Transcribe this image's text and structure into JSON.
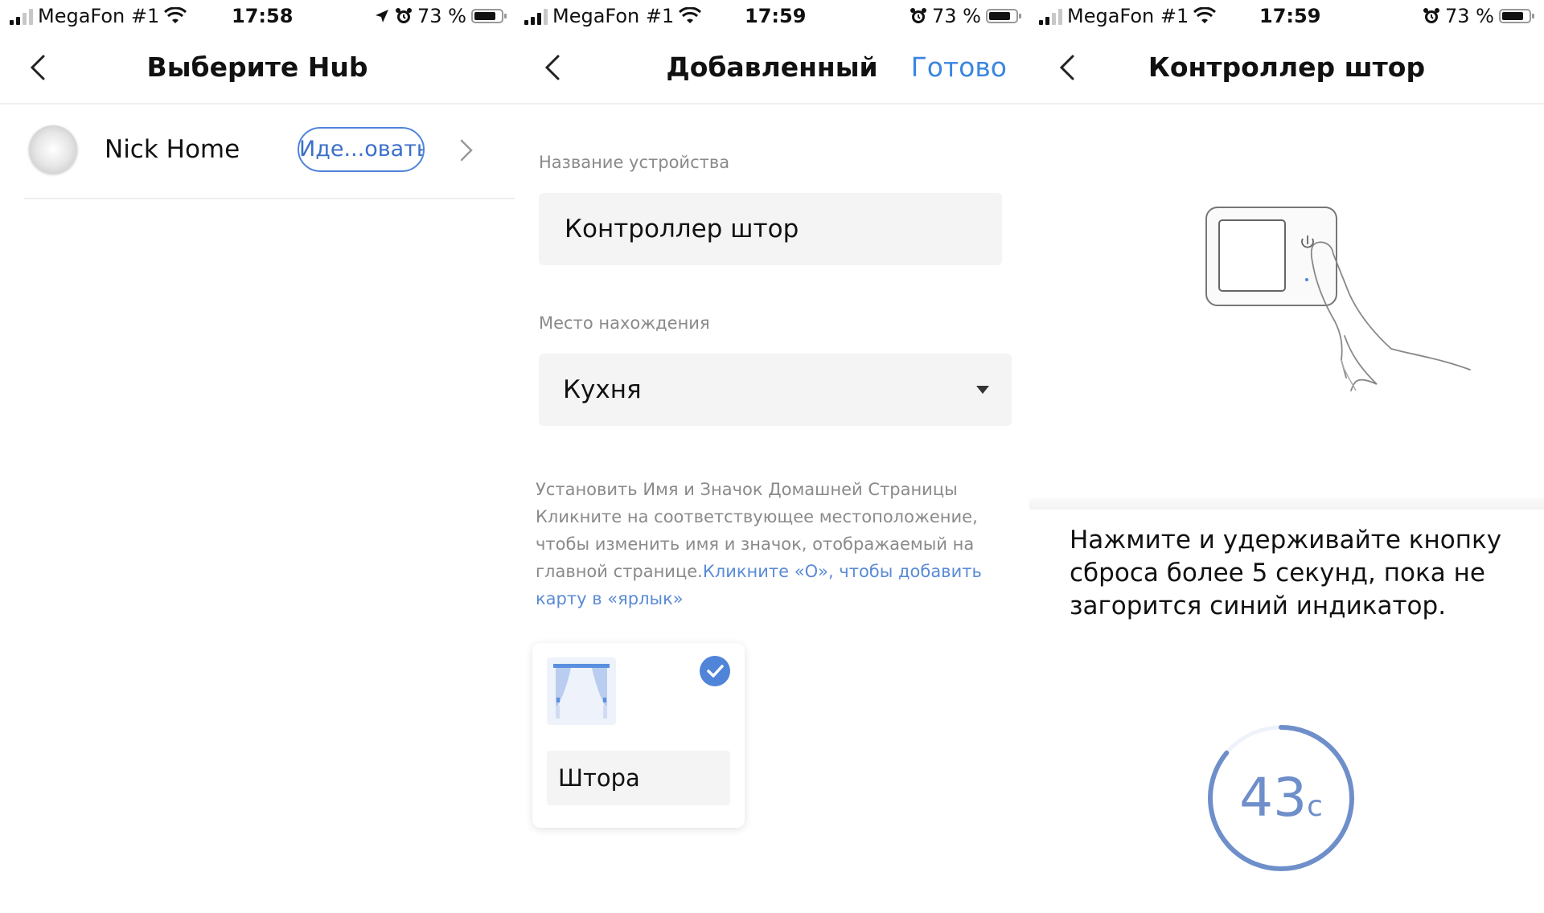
{
  "screens": [
    {
      "status": {
        "carrier": "MegaFon #1",
        "time": "17:58",
        "battery": "73 %"
      },
      "nav": {
        "title": "Выберите Hub"
      },
      "hub": {
        "name": "Nick Home",
        "badge": "Иде...овать"
      }
    },
    {
      "status": {
        "carrier": "MegaFon #1",
        "time": "17:59",
        "battery": "73 %"
      },
      "nav": {
        "title": "Добавленный",
        "done": "Готово"
      },
      "form": {
        "name_label": "Название устройства",
        "name_value": "Контроллер штор",
        "location_label": "Место нахождения",
        "location_value": "Кухня",
        "hint_text": "Установить Имя и Значок Домашней Страницы Кликните на соответствующее местоположение, чтобы изменить имя и значок, отображаемый на главной странице.",
        "hint_link": "Кликните «О», чтобы добавить карту в «ярлык»",
        "card_name": "Штора"
      }
    },
    {
      "status": {
        "carrier": "MegaFon #1",
        "time": "17:59",
        "battery": "73 %"
      },
      "nav": {
        "title": "Контроллер штор"
      },
      "instruction": "Нажмите и удерживайте кнопку сброса более 5 секунд, пока не загорится синий индикатор.",
      "timer": {
        "value": "43",
        "unit": "с",
        "progress": 0.86
      }
    }
  ],
  "colors": {
    "accent": "#3b86e0",
    "hint_link": "#5a8bd6",
    "timer": "#6f8fca"
  },
  "icons": [
    "signal-icon",
    "wifi-icon",
    "location-arrow-icon",
    "alarm-icon",
    "battery-icon",
    "back-chevron-icon",
    "chevron-right-icon",
    "check-icon",
    "curtain-icon",
    "dropdown-arrow-icon"
  ]
}
